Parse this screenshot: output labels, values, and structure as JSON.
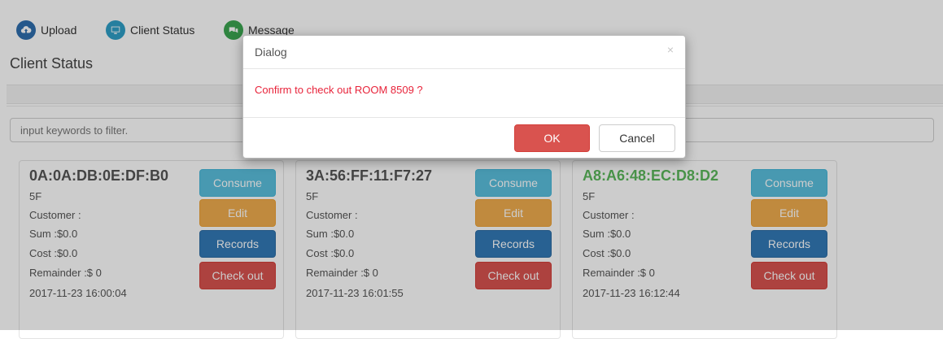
{
  "nav": {
    "upload": "Upload",
    "client_status": "Client Status",
    "message": "Message",
    "icons": [
      "cloud-upload-icon",
      "monitor-icon",
      "chat-icon"
    ],
    "colors": {
      "upload": "#2f6fae",
      "client_status": "#2f9fc7",
      "message": "#3ba551"
    }
  },
  "section_title": "Client Status",
  "filter": {
    "placeholder": "input keywords to filter.",
    "value": ""
  },
  "cards": [
    {
      "mac": "0A:0A:DB:0E:DF:B0",
      "floor": "5F",
      "customer": "Customer :",
      "sum": "Sum :$0.0",
      "cost": "Cost :$0.0",
      "remainder": "Remainder :$ 0",
      "time": "2017-11-23 16:00:04",
      "online": false
    },
    {
      "mac": "3A:56:FF:11:F7:27",
      "floor": "5F",
      "customer": "Customer :",
      "sum": "Sum :$0.0",
      "cost": "Cost :$0.0",
      "remainder": "Remainder :$ 0",
      "time": "2017-11-23 16:01:55",
      "online": false
    },
    {
      "mac": "A8:A6:48:EC:D8:D2",
      "floor": "5F",
      "customer": "Customer :",
      "sum": "Sum :$0.0",
      "cost": "Cost :$0.0",
      "remainder": "Remainder :$ 0",
      "time": "2017-11-23 16:12:44",
      "online": true
    }
  ],
  "card_buttons": {
    "consume": "Consume",
    "edit": "Edit",
    "records": "Records",
    "checkout": "Check out"
  },
  "dialog": {
    "title": "Dialog",
    "close": "×",
    "message": "Confirm to check out ROOM 8509 ?",
    "ok": "OK",
    "cancel": "Cancel"
  },
  "colors": {
    "online_mac": "#5cb85c",
    "message_text": "#e8233a"
  }
}
